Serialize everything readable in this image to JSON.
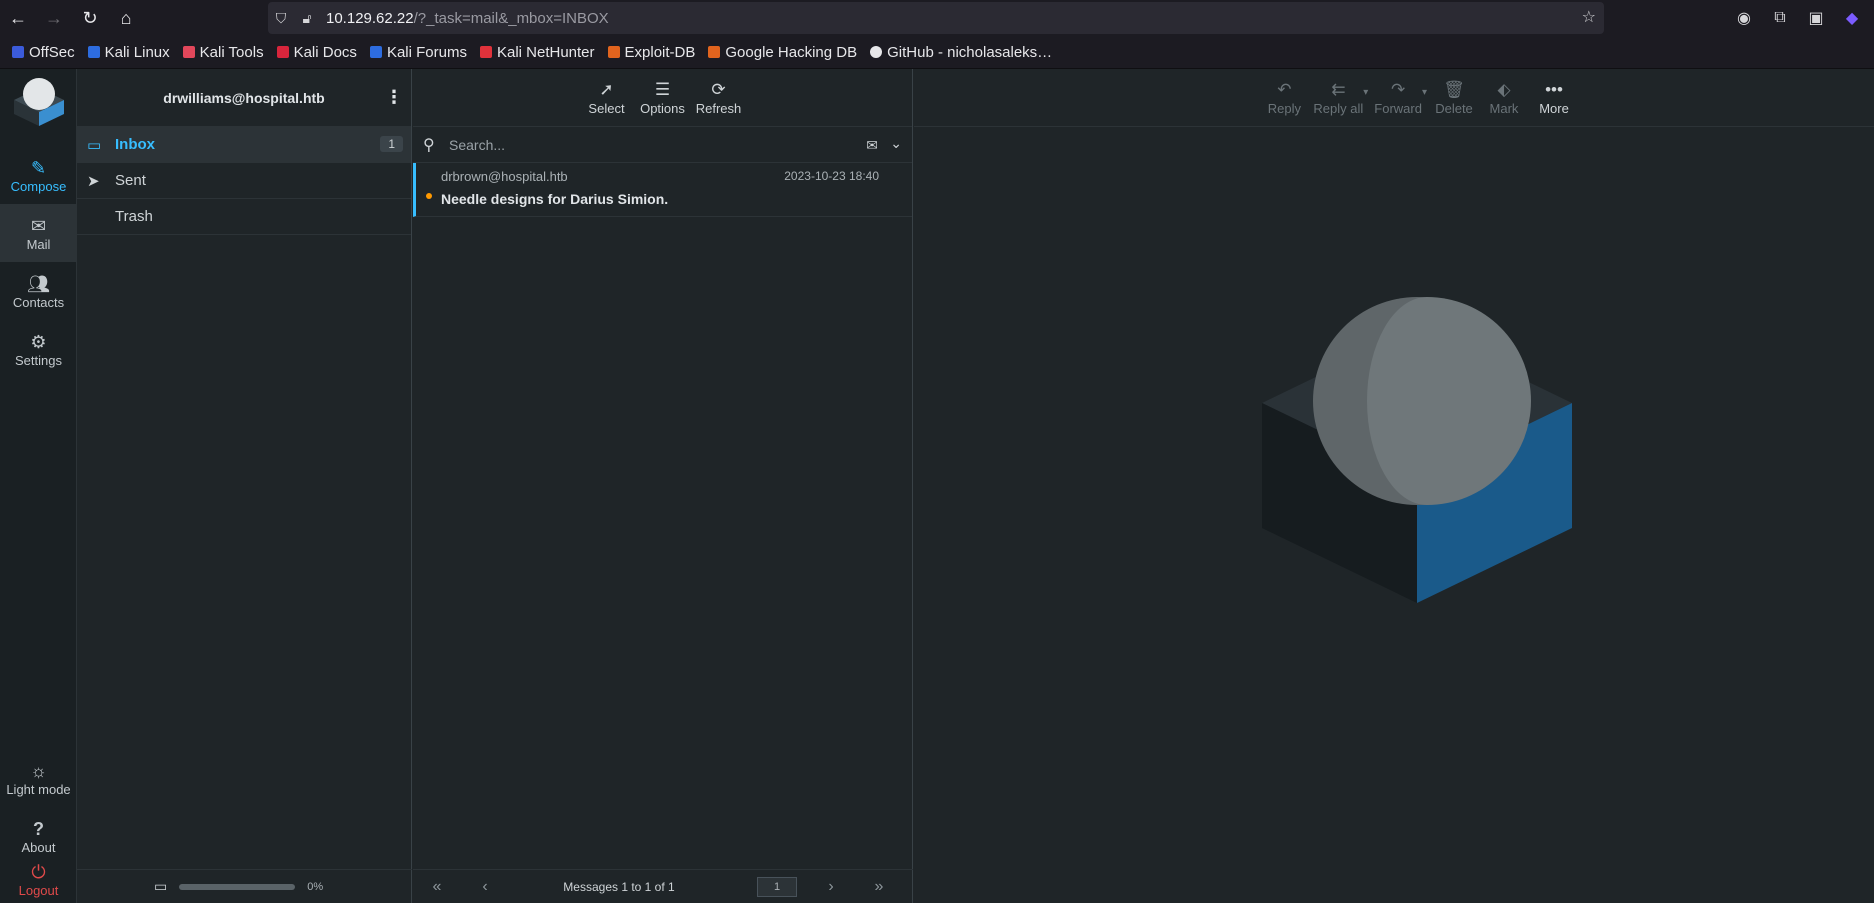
{
  "browser": {
    "url_host": "10.129.62.22",
    "url_path": "/?_task=mail&_mbox=INBOX",
    "bookmarks": [
      {
        "label": "OffSec",
        "color": "#3b5bdb"
      },
      {
        "label": "Kali Linux",
        "color": "#2d6cdf"
      },
      {
        "label": "Kali Tools",
        "color": "#e2475b"
      },
      {
        "label": "Kali Docs",
        "color": "#d8253c"
      },
      {
        "label": "Kali Forums",
        "color": "#2d6cdf"
      },
      {
        "label": "Kali NetHunter",
        "color": "#e0323b"
      },
      {
        "label": "Exploit-DB",
        "color": "#e2641e"
      },
      {
        "label": "Google Hacking DB",
        "color": "#e2641e"
      },
      {
        "label": "GitHub - nicholasaleks…",
        "color": "#e7e7ea"
      }
    ]
  },
  "rail": {
    "compose": "Compose",
    "mail": "Mail",
    "contacts": "Contacts",
    "settings": "Settings",
    "light_mode": "Light mode",
    "about": "About",
    "logout": "Logout"
  },
  "folders": {
    "account": "drwilliams@hospital.htb",
    "inbox": "Inbox",
    "inbox_unread": "1",
    "sent": "Sent",
    "trash": "Trash",
    "quota_percent": "0%",
    "quota_fraction": 0
  },
  "list_toolbar": {
    "select": "Select",
    "options": "Options",
    "refresh": "Refresh"
  },
  "search": {
    "placeholder": "Search..."
  },
  "messages": [
    {
      "from": "drbrown@hospital.htb",
      "date": "2023-10-23 18:40",
      "subject": "Needle designs for Darius Simion."
    }
  ],
  "pager": {
    "info": "Messages 1 to 1 of 1",
    "page": "1"
  },
  "preview_toolbar": {
    "reply": "Reply",
    "reply_all": "Reply all",
    "forward": "Forward",
    "delete": "Delete",
    "mark": "Mark",
    "more": "More"
  },
  "colors": {
    "accent": "#37beff",
    "unread_dot": "#ff9900",
    "logout": "#e04a4a"
  }
}
